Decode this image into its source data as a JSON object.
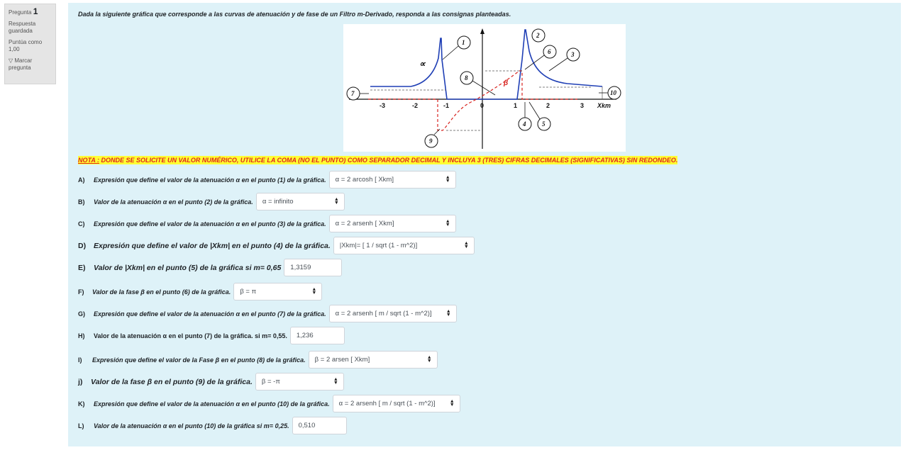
{
  "question_info": {
    "label": "Pregunta",
    "number": "1",
    "status": "Respuesta guardada",
    "score": "Puntúa como 1,00",
    "flag_label": "Marcar pregunta"
  },
  "question_text": "Dada la siguiente gráfica que corresponde a las curvas de atenuación y de fase de un Filtro m-Derivado, responda a las consignas planteadas.",
  "figure": {
    "x_ticks": [
      "-3",
      "-2",
      "-1",
      "0",
      "1",
      "2",
      "3"
    ],
    "x_axis_label": "Xkm",
    "alpha_label": "∝",
    "beta_label": "β",
    "markers": [
      "1",
      "2",
      "3",
      "4",
      "5",
      "6",
      "7",
      "8",
      "9",
      "10"
    ]
  },
  "nota": {
    "prefix": "NOTA :",
    "text": " DONDE SE SOLICITE UN VALOR NUMÉRICO, UTILICE LA COMA (NO EL PUNTO) COMO SEPARADOR  DECIMAL Y INCLUYA 3 (TRES) CIFRAS DECIMALES (SIGNIFICATIVAS) SIN REDONDEO."
  },
  "items": [
    {
      "letter": "A)",
      "text": "Expresión que define el valor de la atenuación α en el punto (1) de la gráfica.",
      "type": "select",
      "value": "α = 2 arcosh [ Xkm]"
    },
    {
      "letter": "B)",
      "text": "Valor de la atenuación α en el punto (2) de la gráfica.",
      "type": "select",
      "value": "α = infinito"
    },
    {
      "letter": "C)",
      "text": "Expresión que define el valor de la atenuación α en el punto (3) de la gráfica.",
      "type": "select",
      "value": "α = 2 arsenh [ Xkm]"
    },
    {
      "letter": "D)",
      "text": "Expresión que define el valor de |Xkm| en el punto (4) de la gráfica.",
      "type": "select",
      "value": "|Xkm|= [ 1 / sqrt (1 - m^2)]"
    },
    {
      "letter": "E)",
      "text": "Valor de |Xkm| en el punto (5) de la gráfica si  m= 0,65",
      "type": "input",
      "value": "1,3159"
    },
    {
      "letter": "F)",
      "text": "Valor de la fase β en el punto (6) de la gráfica.",
      "type": "select",
      "value": "β = π"
    },
    {
      "letter": "G)",
      "text": "Expresión que define el valor de la atenuación α en el punto (7) de la gráfica.",
      "type": "select",
      "value": "α = 2 arsenh [ m / sqrt (1 - m^2)]"
    },
    {
      "letter": "H)",
      "text": "Valor de la atenuación α en el punto (7) de la gráfica. si m= 0,55.",
      "type": "input",
      "value": "1,236"
    },
    {
      "letter": "I)",
      "text": "Expresión que define el valor de la Fase β en el punto (8) de la gráfica.",
      "type": "select",
      "value": "β =  2 arsen [ Xkm]"
    },
    {
      "letter": "j)",
      "text": "Valor de la fase β en el punto (9) de la gráfica.",
      "type": "select",
      "value": "β = -π"
    },
    {
      "letter": "K)",
      "text": "Expresión que define el valor de la atenuación α en el punto (10) de la gráfica.",
      "type": "select",
      "value": "α = 2 arsenh [ m / sqrt (1 - m^2)]"
    },
    {
      "letter": "L)",
      "text": "Valor de la atenuación α en el punto (10) de la gráfica si m= 0,25.",
      "type": "input",
      "value": "0,510"
    }
  ]
}
